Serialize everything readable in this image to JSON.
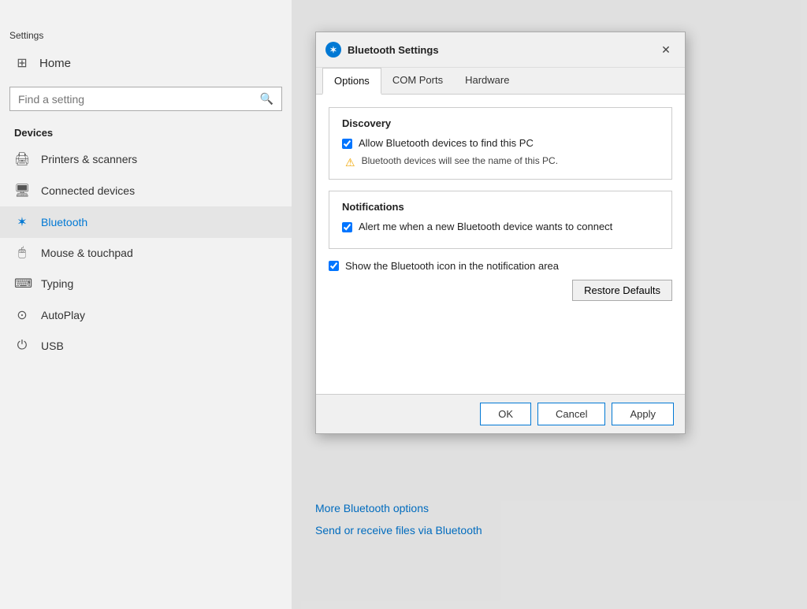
{
  "app": {
    "title": "Settings"
  },
  "sidebar": {
    "home_label": "Home",
    "search_placeholder": "Find a setting",
    "section_title": "Devices",
    "nav_items": [
      {
        "id": "printers",
        "label": "Printers & scanners",
        "icon": "🖨"
      },
      {
        "id": "connected",
        "label": "Connected devices",
        "icon": "🖥"
      },
      {
        "id": "bluetooth",
        "label": "Bluetooth",
        "icon": "⚡",
        "active": true
      },
      {
        "id": "mouse",
        "label": "Mouse & touchpad",
        "icon": "🖱"
      },
      {
        "id": "typing",
        "label": "Typing",
        "icon": "⌨"
      },
      {
        "id": "autoplay",
        "label": "AutoPlay",
        "icon": "▶"
      },
      {
        "id": "usb",
        "label": "USB",
        "icon": "🔌"
      }
    ]
  },
  "dialog": {
    "title": "Bluetooth Settings",
    "close_label": "✕",
    "tabs": [
      {
        "id": "options",
        "label": "Options",
        "active": true
      },
      {
        "id": "com_ports",
        "label": "COM Ports"
      },
      {
        "id": "hardware",
        "label": "Hardware"
      }
    ],
    "discovery_section": {
      "title": "Discovery",
      "allow_checkbox_label": "Allow Bluetooth devices to find this PC",
      "allow_checked": true,
      "warning_text": "Bluetooth devices will see the name of this PC."
    },
    "notifications_section": {
      "title": "Notifications",
      "alert_checkbox_label": "Alert me when a new Bluetooth device wants to connect",
      "alert_checked": true
    },
    "show_icon_checkbox_label": "Show the Bluetooth icon in the notification area",
    "show_icon_checked": true,
    "restore_defaults_label": "Restore Defaults",
    "footer": {
      "ok_label": "OK",
      "cancel_label": "Cancel",
      "apply_label": "Apply"
    }
  },
  "main_links": {
    "more_bluetooth": "More Bluetooth options",
    "send_receive": "Send or receive files via Bluetooth"
  },
  "icons": {
    "bluetooth_symbol": "⚡",
    "home_icon": "⌂",
    "search_icon": "🔍",
    "warning": "⚠"
  }
}
